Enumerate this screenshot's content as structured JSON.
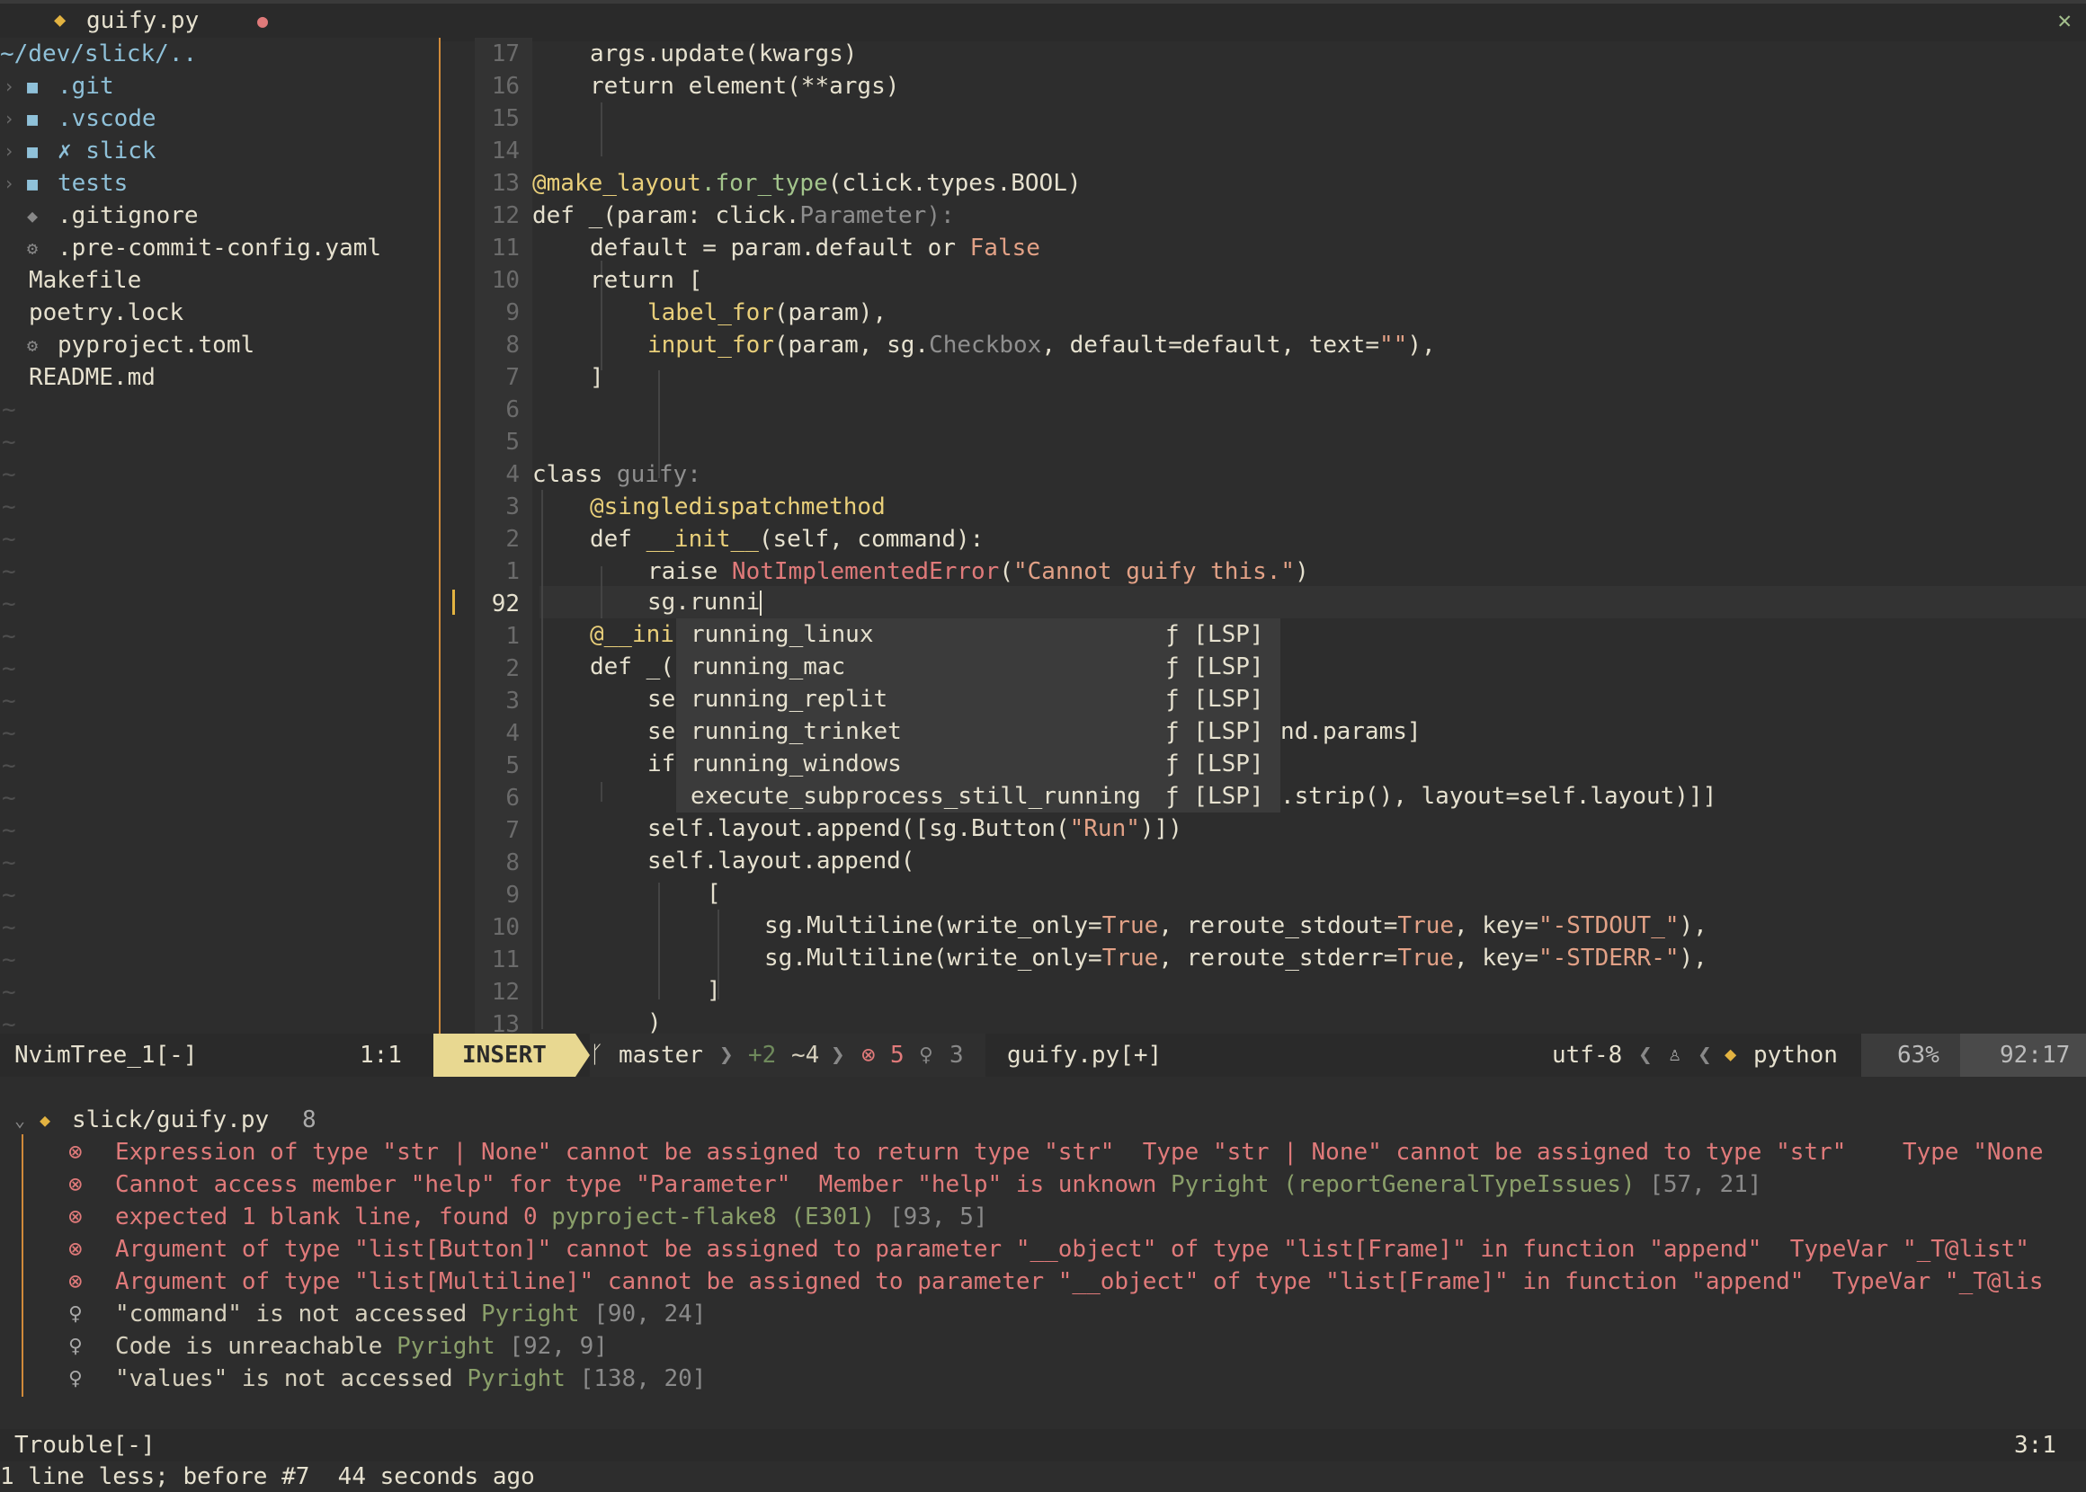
{
  "tabline": {
    "icon": "python-icon",
    "filename": "guify.py",
    "modified_dot": "●",
    "close": "✕"
  },
  "tree": {
    "root": "~/dev/slick/..",
    "items": [
      {
        "name": ".git",
        "type": "dir",
        "arrow": "›",
        "icon": "■"
      },
      {
        "name": ".vscode",
        "type": "dir",
        "arrow": "›",
        "icon": "■"
      },
      {
        "name": "✗ slick",
        "type": "dir",
        "arrow": "›",
        "icon": "■"
      },
      {
        "name": "tests",
        "type": "dir",
        "arrow": "›",
        "icon": "■"
      },
      {
        "name": ".gitignore",
        "type": "file",
        "icon": "◆"
      },
      {
        "name": ".pre-commit-config.yaml",
        "type": "file",
        "icon": "⚙"
      },
      {
        "name": "Makefile",
        "type": "file",
        "icon": ""
      },
      {
        "name": "poetry.lock",
        "type": "file",
        "icon": ""
      },
      {
        "name": "pyproject.toml",
        "type": "file",
        "icon": "⚙"
      },
      {
        "name": "README.md",
        "type": "file",
        "icon": ""
      }
    ],
    "filler": "~"
  },
  "editor": {
    "line_numbers": [
      "17",
      "16",
      "15",
      "14",
      "13",
      "12",
      "11",
      "10",
      "9",
      "8",
      "7",
      "6",
      "5",
      "4",
      "3",
      "2",
      "1",
      "92",
      "1",
      "2",
      "3",
      "4",
      "5",
      "6",
      "7",
      "8",
      "9",
      "10",
      "11",
      "12",
      "13"
    ],
    "code": {
      "l1": "args.update(kwargs)",
      "l2": "return element(**args)",
      "l5a": "@make_layout",
      "l5b": ".for_type",
      "l5c": "(click.types.BOOL)",
      "l6a": "def _(param: click.",
      "l6b": "Parameter",
      "l6c": "):",
      "l7a": "default = param.default or ",
      "l7b": "False",
      "l8": "return [",
      "l9a": "label_for",
      "l9b": "(param),",
      "l10a": "input_for",
      "l10b": "(param, sg.",
      "l10c": "Checkbox",
      "l10d": ", default=default, text=",
      "l10e": "\"\"",
      "l10f": "),",
      "l11": "]",
      "l14a": "class ",
      "l14b": "guify:",
      "l15": "@singledispatchmethod",
      "l16a": "def ",
      "l16b": "__init__",
      "l16c": "(self, command):",
      "l17a": "raise ",
      "l17b": "NotImplementedError",
      "l17c": "(",
      "l17d": "\"Cannot guify this.\"",
      "l17e": ")",
      "l18": "sg.runni",
      "l19": "@__ini",
      "l20": "def _(",
      "l21": "se",
      "l22a": "se",
      "l22b": "nd.params]",
      "l23": "if",
      "l24": ".strip(), layout=self.layout)]]",
      "l25a": "self.layout.append([sg.Button(",
      "l25b": "\"Run\"",
      "l25c": ")])",
      "l26": "self.layout.append(",
      "l27": "[",
      "l28a": "sg.Multiline(write_only=",
      "l28b": "True",
      "l28c": ", reroute_stdout=",
      "l28d": "True",
      "l28e": ", key=",
      "l28f": "\"-STDOUT_\"",
      "l28g": "),",
      "l29a": "sg.Multiline(write_only=",
      "l29b": "True",
      "l29c": ", reroute_stderr=",
      "l29d": "True",
      "l29e": ", key=",
      "l29f": "\"-STDERR-\"",
      "l29g": "),",
      "l30": "]",
      "l31": ")"
    }
  },
  "completion": {
    "items": [
      {
        "label": "running_linux",
        "kind": "ƒ [LSP]"
      },
      {
        "label": "running_mac",
        "kind": "ƒ [LSP]"
      },
      {
        "label": "running_replit",
        "kind": "ƒ [LSP]"
      },
      {
        "label": "running_trinket",
        "kind": "ƒ [LSP]"
      },
      {
        "label": "running_windows",
        "kind": "ƒ [LSP]"
      },
      {
        "label": "execute_subprocess_still_running",
        "kind": "ƒ [LSP]"
      }
    ]
  },
  "statusline": {
    "tree_name": "NvimTree_1[-]",
    "tree_pos": "1:1",
    "mode": "INSERT",
    "branch_icon": "ᚴ",
    "branch": "master",
    "git_added": "+2",
    "git_changed": "~4",
    "errors_icon": "⊗",
    "errors": "5",
    "hints_icon": "♀",
    "hints": "3",
    "file": "guify.py[+]",
    "encoding": "utf-8",
    "os_icon": "♙",
    "ft_icon": "python-icon",
    "filetype": "python",
    "percent": "63%",
    "position": "92:17"
  },
  "trouble": {
    "header_file": "slick/guify.py",
    "header_count": "8",
    "items": [
      {
        "icon": "⊗",
        "severity": "error",
        "msg": "Expression of type \"str | None\" cannot be assigned to return type \"str\"  Type \"str | None\" cannot be assigned to type \"str\"    Type \"None",
        "source": "",
        "pos": ""
      },
      {
        "icon": "⊗",
        "severity": "error",
        "msg": "Cannot access member \"help\" for type \"Parameter\"  Member \"help\" is unknown ",
        "source": "Pyright (reportGeneralTypeIssues)",
        "pos": " [57, 21]"
      },
      {
        "icon": "⊗",
        "severity": "error",
        "msg": "expected 1 blank line, found 0 ",
        "source": "pyproject-flake8 (E301)",
        "pos": " [93, 5]"
      },
      {
        "icon": "⊗",
        "severity": "error",
        "msg": "Argument of type \"list[Button]\" cannot be assigned to parameter \"__object\" of type \"list[Frame]\" in function \"append\"  TypeVar \"_T@list\"",
        "source": "",
        "pos": ""
      },
      {
        "icon": "⊗",
        "severity": "error",
        "msg": "Argument of type \"list[Multiline]\" cannot be assigned to parameter \"__object\" of type \"list[Frame]\" in function \"append\"  TypeVar \"_T@lis",
        "source": "",
        "pos": ""
      },
      {
        "icon": "♀",
        "severity": "hint",
        "msg": "\"command\" is not accessed ",
        "source": "Pyright",
        "pos": " [90, 24]"
      },
      {
        "icon": "♀",
        "severity": "hint",
        "msg": "Code is unreachable ",
        "source": "Pyright",
        "pos": " [92, 9]"
      },
      {
        "icon": "♀",
        "severity": "hint",
        "msg": "\"values\" is not accessed ",
        "source": "Pyright",
        "pos": " [138, 20]"
      }
    ],
    "status_name": "Trouble[-]",
    "status_pos": "3:1"
  },
  "cmdline": "1 line less; before #7  44 seconds ago",
  "colors": {
    "accent": "#e8d891",
    "error": "#e07a7a",
    "separator": "#d08a3a",
    "function": "#e9cf7a",
    "attribute": "#a3c58c",
    "string": "#e2a186"
  }
}
